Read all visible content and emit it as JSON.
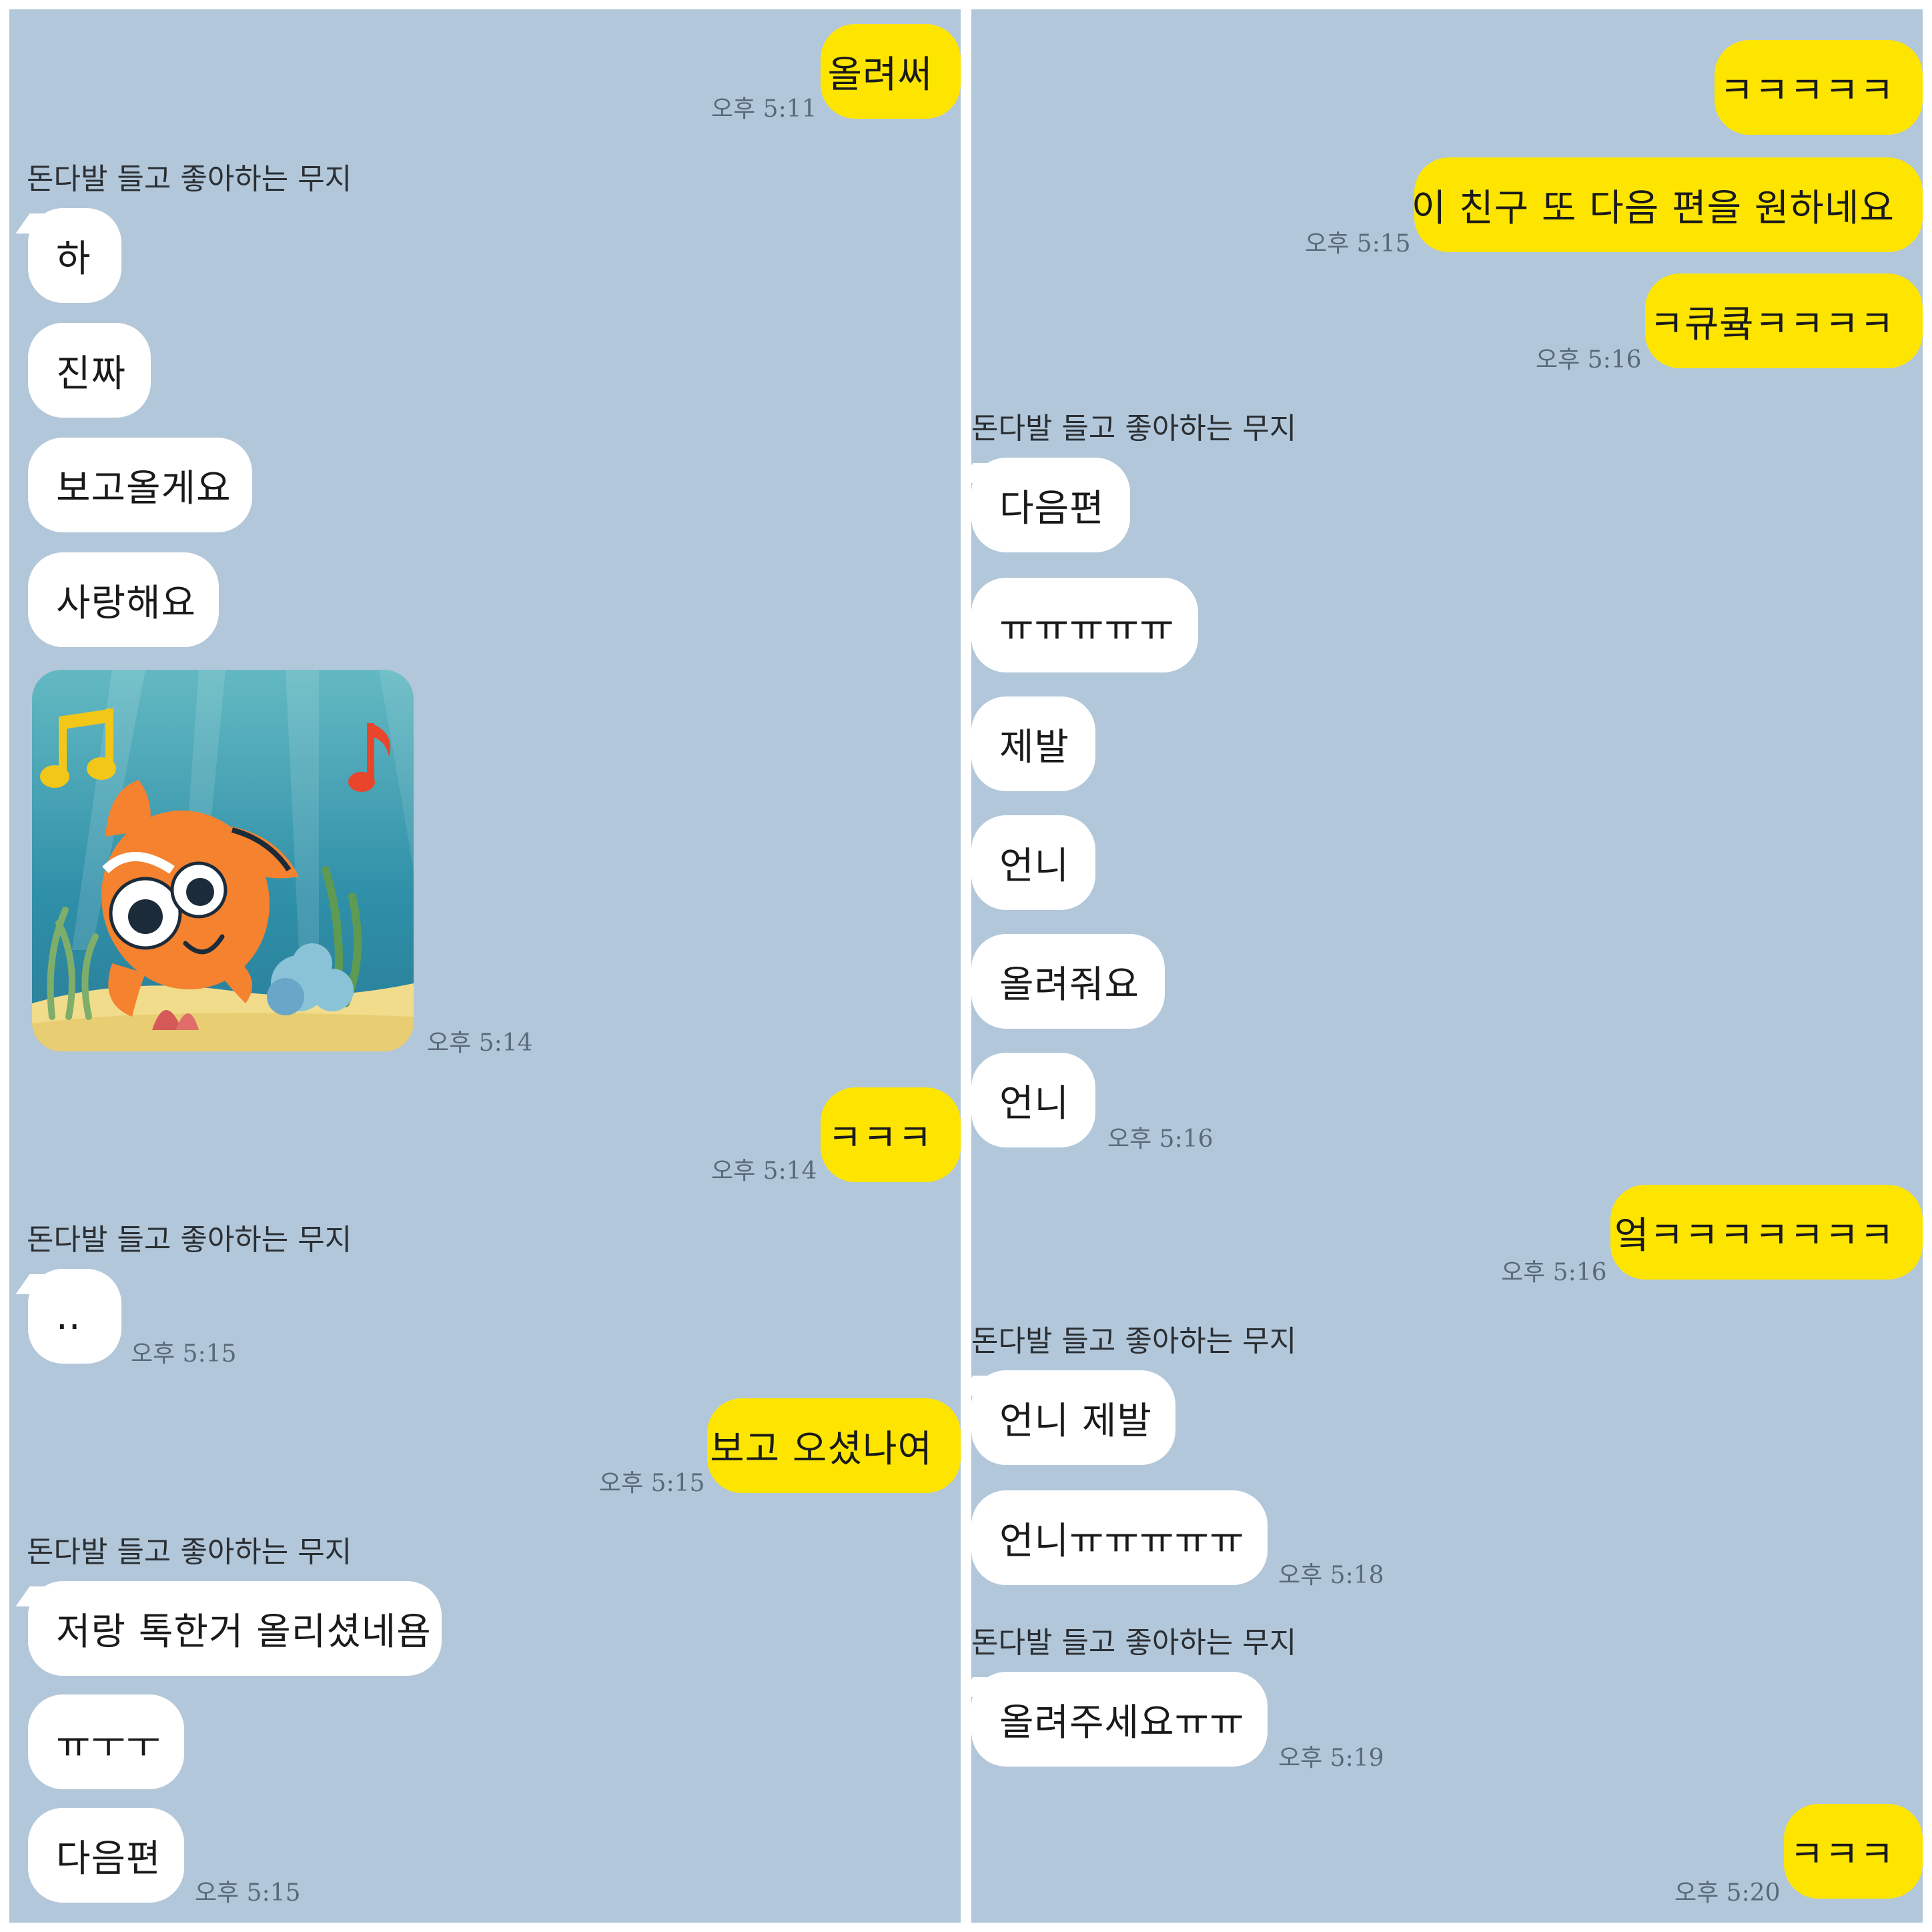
{
  "sender_name": "돈다발 들고 좋아하는 무지",
  "left_panel": {
    "messages": [
      {
        "text": "올려써",
        "time": "오후 5:11"
      },
      {
        "text": "하"
      },
      {
        "text": "진짜"
      },
      {
        "text": "보고올게요"
      },
      {
        "text": "사랑해요"
      },
      {
        "time": "오후 5:14"
      },
      {
        "text": "ㅋㅋㅋ",
        "time": "오후 5:14"
      },
      {
        "text": "..",
        "time": "오후 5:15"
      },
      {
        "text": "보고 오셨나여",
        "time": "오후 5:15"
      },
      {
        "text": "저랑 톡한거 올리셨네욤"
      },
      {
        "text": "ㅠㅜㅜ"
      },
      {
        "text": "다음편",
        "time": "오후 5:15"
      }
    ]
  },
  "right_panel": {
    "messages": [
      {
        "text": "ㅋㅋㅋㅋㅋ"
      },
      {
        "text": "이 친구 또 다음 편을 원하네요",
        "time": "오후 5:15"
      },
      {
        "text": "ㅋ큐큨ㅋㅋㅋㅋ",
        "time": "오후 5:16"
      },
      {
        "text": "다음편"
      },
      {
        "text": "ㅠㅠㅠㅠㅠ"
      },
      {
        "text": "제발"
      },
      {
        "text": "언니"
      },
      {
        "text": "올려줘요"
      },
      {
        "text": "언니",
        "time": "오후 5:16"
      },
      {
        "text": "엌ㅋㅋㅋㅋㅋㅋㅋ",
        "time": "오후 5:16"
      },
      {
        "text": "언니 제발"
      },
      {
        "text": "언니ㅠㅠㅠㅠㅠ",
        "time": "오후 5:18"
      },
      {
        "text": "올려주세요ㅠㅠ",
        "time": "오후 5:19"
      },
      {
        "text": "ㅋㅋㅋ",
        "time": "오후 5:20"
      }
    ]
  },
  "colors": {
    "background": "#b2c7da",
    "outgoing": "#fee500",
    "incoming": "#ffffff"
  },
  "icons": {
    "emoticon": "clownfish-music-emoticon"
  }
}
